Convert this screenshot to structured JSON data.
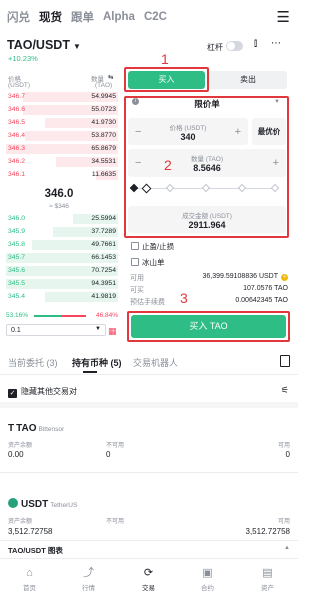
{
  "top_tabs": [
    "闪兑",
    "现货",
    "跟单",
    "Alpha",
    "C2C"
  ],
  "active_top_tab": "现货",
  "pair": {
    "symbol": "TAO/USDT",
    "change": "+10.23%"
  },
  "leverage_label": "杠杆",
  "orderbook": {
    "price_header": "价格",
    "price_unit": "(USDT)",
    "qty_header": "数量",
    "qty_unit": "(TAO)",
    "asks": [
      {
        "price": "346.7",
        "qty": "54.9945",
        "depth": 0.85
      },
      {
        "price": "346.6",
        "qty": "55.0723",
        "depth": 0.85
      },
      {
        "price": "346.5",
        "qty": "41.9730",
        "depth": 0.65
      },
      {
        "price": "346.4",
        "qty": "53.8770",
        "depth": 0.83
      },
      {
        "price": "346.3",
        "qty": "65.8679",
        "depth": 1.0
      },
      {
        "price": "346.2",
        "qty": "34.5531",
        "depth": 0.55
      },
      {
        "price": "346.1",
        "qty": "11.6635",
        "depth": 0.2
      }
    ],
    "mid_price": "346.0",
    "mid_fiat": "≈ $346",
    "bids": [
      {
        "price": "346.0",
        "qty": "25.5994",
        "depth": 0.4
      },
      {
        "price": "345.9",
        "qty": "37.7289",
        "depth": 0.58
      },
      {
        "price": "345.8",
        "qty": "49.7661",
        "depth": 0.77
      },
      {
        "price": "345.7",
        "qty": "66.1453",
        "depth": 1.0
      },
      {
        "price": "345.6",
        "qty": "70.7254",
        "depth": 1.0
      },
      {
        "price": "345.5",
        "qty": "94.3951",
        "depth": 1.0
      },
      {
        "price": "345.4",
        "qty": "41.9819",
        "depth": 0.65
      }
    ],
    "buy_ratio": "53.16%",
    "sell_ratio": "46.84%",
    "precision": "0.1"
  },
  "trade": {
    "buy_tab": "买入",
    "sell_tab": "卖出",
    "order_type": "限价单",
    "price_label": "价格 (USDT)",
    "price_value": "340",
    "best_price_btn": "最优价",
    "qty_label": "数量 (TAO)",
    "qty_value": "8.5646",
    "total_label": "成交金额 (USDT)",
    "total_value": "2911.964",
    "take_profit_label": "止盈/止损",
    "iceberg_label": "冰山单",
    "available_label": "可用",
    "available_value": "36,399.59108836 USDT",
    "can_buy_label": "可买",
    "can_buy_value": "107.0576 TAO",
    "fee_label": "预估手续费",
    "fee_value": "0.00642345 TAO",
    "buy_button": "买入 TAO"
  },
  "annotations": {
    "n1": "1",
    "n2": "2",
    "n3": "3"
  },
  "bottom_section": {
    "tabs": [
      "当前委托 (3)",
      "持有币种 (5)",
      "交易机器人"
    ],
    "hide_other_label": "隐藏其他交易对",
    "col_balance": "资产余额",
    "col_unavailable": "不可用",
    "col_available": "可用",
    "assets": [
      {
        "symbol": "TAO",
        "name": "Bittensor",
        "balance": "0.00",
        "unavailable": "0",
        "available": "0"
      },
      {
        "symbol": "USDT",
        "name": "TetherUS",
        "balance": "3,512.72758",
        "unavailable": "",
        "available": "3,512.72758"
      }
    ],
    "chart_bar": "TAO/USDT 图表"
  },
  "bottom_nav": [
    {
      "label": "首页",
      "icon": "home-icon"
    },
    {
      "label": "行情",
      "icon": "markets-icon"
    },
    {
      "label": "交易",
      "icon": "trade-icon"
    },
    {
      "label": "合约",
      "icon": "futures-icon"
    },
    {
      "label": "资产",
      "icon": "wallet-icon"
    }
  ],
  "colors": {
    "green": "#2ebd85",
    "red": "#f6465d",
    "annotation": "#e0383c"
  }
}
